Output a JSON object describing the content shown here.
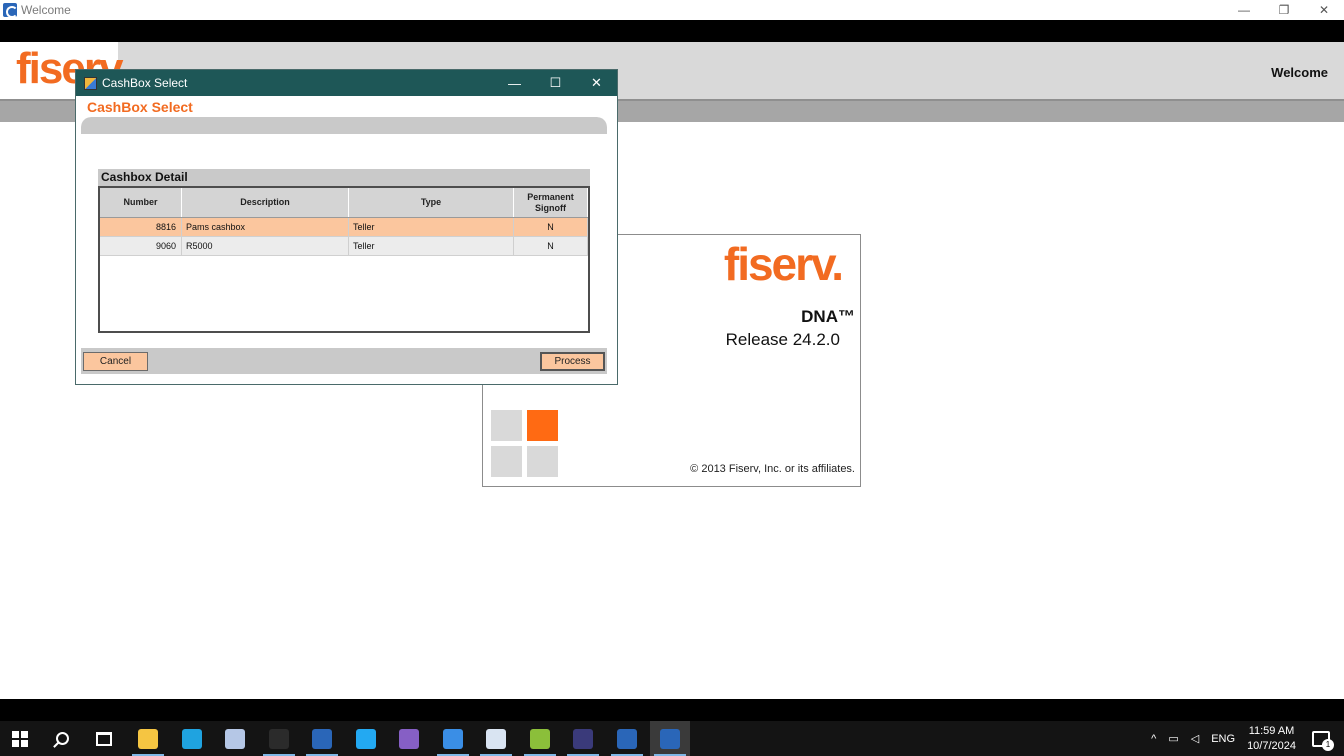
{
  "window": {
    "title": "Welcome",
    "minimize": "—",
    "restore": "❐",
    "close": "✕"
  },
  "header": {
    "logo": "fiserv.",
    "welcome": "Welcome"
  },
  "splash": {
    "logo": "fiserv.",
    "product": "DNA™",
    "release": "Release 24.2.0",
    "copyright": "© 2013 Fiserv, Inc. or its affiliates."
  },
  "dialog": {
    "title": "CashBox Select",
    "heading": "CashBox Select",
    "minimize": "—",
    "maximize": "☐",
    "close": "✕",
    "section_title": "Cashbox Detail",
    "columns": [
      "Number",
      "Description",
      "Type",
      "Permanent Signoff"
    ],
    "rows": [
      {
        "number": "8816",
        "description": "Pams cashbox",
        "type": "Teller",
        "signoff": "N",
        "selected": true
      },
      {
        "number": "9060",
        "description": "R5000",
        "type": "Teller",
        "signoff": "N",
        "selected": false
      }
    ],
    "cancel_label": "Cancel",
    "process_label": "Process"
  },
  "taskbar": {
    "apps": [
      {
        "name": "file-explorer-icon",
        "color": "#f5c542",
        "active": true
      },
      {
        "name": "edge-icon",
        "color": "#1fa3e0",
        "active": false
      },
      {
        "name": "database-tool-icon",
        "color": "#b5c7e6",
        "active": false
      },
      {
        "name": "terminal-icon",
        "color": "#2b2b2b",
        "active": true
      },
      {
        "name": "dna-app-icon",
        "color": "#2a66b8",
        "active": true
      },
      {
        "name": "vscode-icon",
        "color": "#23a9f2",
        "active": false
      },
      {
        "name": "visual-studio-icon",
        "color": "#865fc5",
        "active": false
      },
      {
        "name": "window-app-icon",
        "color": "#3a8ee6",
        "active": true
      },
      {
        "name": "paint-icon",
        "color": "#d9e4f2",
        "active": true
      },
      {
        "name": "notepad-icon",
        "color": "#8bbf3a",
        "active": true
      },
      {
        "name": "eclipse-icon",
        "color": "#3a3a7a",
        "active": true
      },
      {
        "name": "app-window-icon",
        "color": "#2a66b8",
        "active": true
      },
      {
        "name": "dna-welcome-icon",
        "color": "#2a66b8",
        "active": true
      }
    ],
    "language": "ENG",
    "time": "11:59 AM",
    "date": "10/7/2024",
    "notification_count": "1"
  }
}
